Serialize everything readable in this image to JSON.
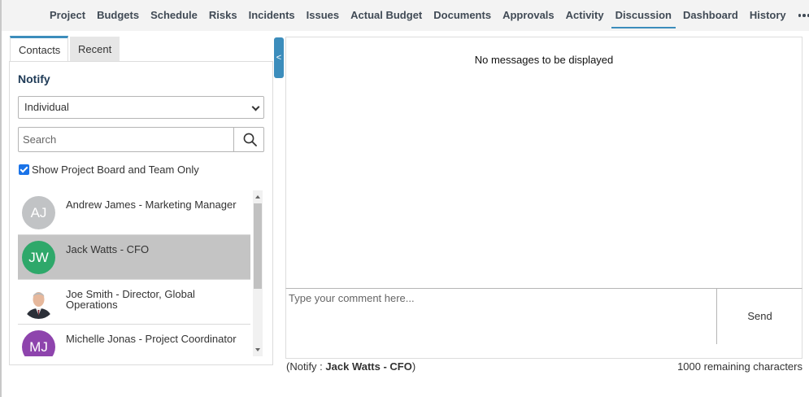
{
  "nav": {
    "tabs": [
      "Project",
      "Budgets",
      "Schedule",
      "Risks",
      "Incidents",
      "Issues",
      "Actual Budget",
      "Documents",
      "Approvals",
      "Activity",
      "Discussion",
      "Dashboard",
      "History"
    ],
    "active": "Discussion",
    "more_icon": "ellipsis-icon"
  },
  "sidebar": {
    "tabs": [
      "Contacts",
      "Recent"
    ],
    "active_tab": "Contacts",
    "notify_title": "Notify",
    "notify_type": "Individual",
    "search_placeholder": "Search",
    "show_board_label": "Show Project Board and Team Only",
    "show_board_checked": true,
    "contacts": [
      {
        "initials": "AJ",
        "name": "Andrew James - Marketing Manager",
        "color": "#c1c3c5",
        "selected": false
      },
      {
        "initials": "JW",
        "name": "Jack Watts - CFO",
        "color": "#2ea86a",
        "selected": true
      },
      {
        "initials": "",
        "name": "Joe Smith - Director, Global Operations",
        "color": "#ffffff",
        "photo": true,
        "selected": false
      },
      {
        "initials": "MJ",
        "name": "Michelle Jonas - Project Coordinator",
        "color": "#8e44ad",
        "selected": false
      }
    ]
  },
  "collapse_label": "<",
  "discussion": {
    "empty_message": "No messages to be displayed",
    "comment_placeholder": "Type your comment here...",
    "send_label": "Send",
    "notify_prefix": "(Notify : ",
    "notify_name": "Jack Watts - CFO",
    "notify_suffix": ")",
    "remaining": "1000 remaining characters"
  },
  "colors": {
    "accent": "#3c8dbc",
    "selected_row": "#c4c4c4"
  }
}
